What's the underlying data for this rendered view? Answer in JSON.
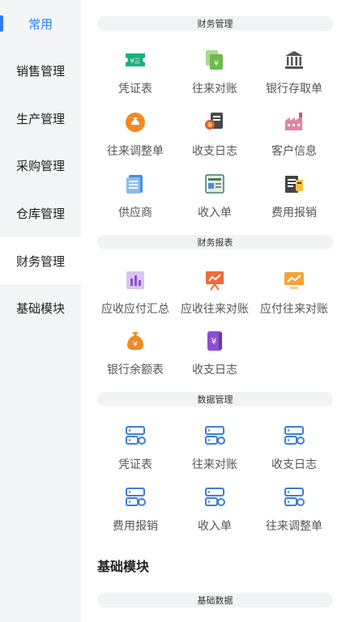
{
  "sidebar": {
    "items": [
      {
        "label": "常用"
      },
      {
        "label": "销售管理"
      },
      {
        "label": "生产管理"
      },
      {
        "label": "采购管理"
      },
      {
        "label": "仓库管理"
      },
      {
        "label": "财务管理"
      },
      {
        "label": "基础模块"
      }
    ]
  },
  "sections": {
    "finance_mgmt": {
      "title": "财务管理",
      "items": [
        {
          "label": "凭证表",
          "icon": "voucher-ticket-icon",
          "color": "#1bb07a"
        },
        {
          "label": "往来对账",
          "icon": "reconciliation-icon",
          "color": "#6dbb4a"
        },
        {
          "label": "银行存取单",
          "icon": "bank-icon",
          "color": "#555555"
        },
        {
          "label": "往来调整单",
          "icon": "money-bag-icon",
          "color": "#f08a24"
        },
        {
          "label": "收支日志",
          "icon": "ledger-coins-icon",
          "color": "#e05a3a"
        },
        {
          "label": "客户信息",
          "icon": "factory-icon",
          "color": "#c0567a"
        },
        {
          "label": "供应商",
          "icon": "document-list-icon",
          "color": "#4a8fd8"
        },
        {
          "label": "收入单",
          "icon": "income-form-icon",
          "color": "#3f7f5f"
        },
        {
          "label": "费用报销",
          "icon": "expense-receipt-icon",
          "color": "#444444"
        }
      ]
    },
    "finance_report": {
      "title": "财务报表",
      "items": [
        {
          "label": "应收应付汇总",
          "icon": "bar-chart-icon",
          "color": "#8a4fd0"
        },
        {
          "label": "应收往来对账",
          "icon": "presentation-board-icon",
          "color": "#f06a3a"
        },
        {
          "label": "应付往来对账",
          "icon": "monitor-chart-icon",
          "color": "#f5a43a"
        },
        {
          "label": "银行余额表",
          "icon": "yuan-bag-icon",
          "color": "#f08a24"
        },
        {
          "label": "收支日志",
          "icon": "yuan-book-icon",
          "color": "#8a4fd0"
        }
      ]
    },
    "data_mgmt": {
      "title": "数据管理",
      "items": [
        {
          "label": "凭证表",
          "icon": "server-gear-icon",
          "color": "#3d7fd6"
        },
        {
          "label": "往来对账",
          "icon": "server-gear-icon",
          "color": "#3d7fd6"
        },
        {
          "label": "收支日志",
          "icon": "server-gear-icon",
          "color": "#3d7fd6"
        },
        {
          "label": "费用报销",
          "icon": "server-gear-icon",
          "color": "#3d7fd6"
        },
        {
          "label": "收入单",
          "icon": "server-gear-icon",
          "color": "#3d7fd6"
        },
        {
          "label": "往来调整单",
          "icon": "server-gear-icon",
          "color": "#3d7fd6"
        }
      ]
    },
    "base_module": {
      "heading": "基础模块",
      "sub_title": "基础数据"
    }
  },
  "colors": {
    "accent": "#2f7cf6",
    "sidebar_bg": "#f4f5f7",
    "section_bar_bg": "#f2f3f5"
  }
}
